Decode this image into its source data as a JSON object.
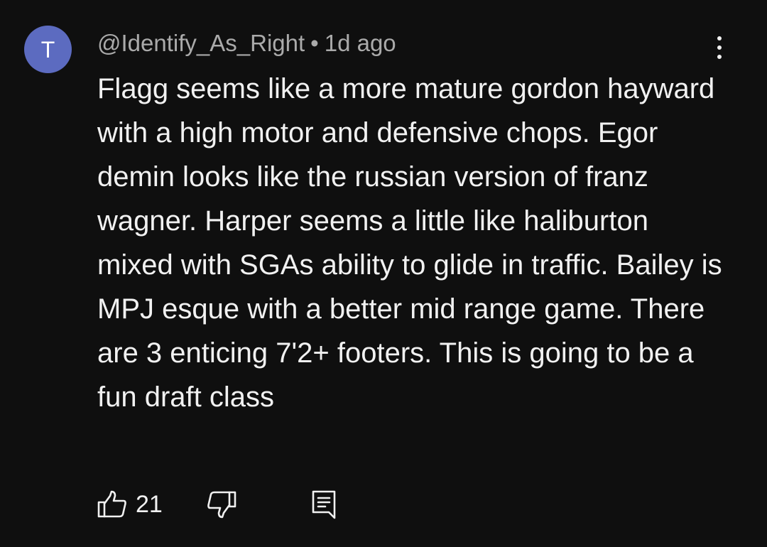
{
  "comment": {
    "avatar_initial": "T",
    "avatar_color": "#5c6bc0",
    "author": "@Identify_As_Right",
    "separator": "•",
    "timestamp": "1d ago",
    "text": "Flagg seems like a more mature gordon hayward with a high motor and defensive chops. Egor demin looks like the russian version of franz wagner. Harper seems a little like haliburton mixed with SGAs ability to glide in traffic. Bailey is MPJ esque with a better mid range game. There are 3 enticing 7'2+ footers. This is going to be a fun draft class",
    "like_count": "21"
  },
  "icons": {
    "like": "thumbs-up-icon",
    "dislike": "thumbs-down-icon",
    "reply": "comment-reply-icon",
    "more": "more-vertical-icon"
  }
}
